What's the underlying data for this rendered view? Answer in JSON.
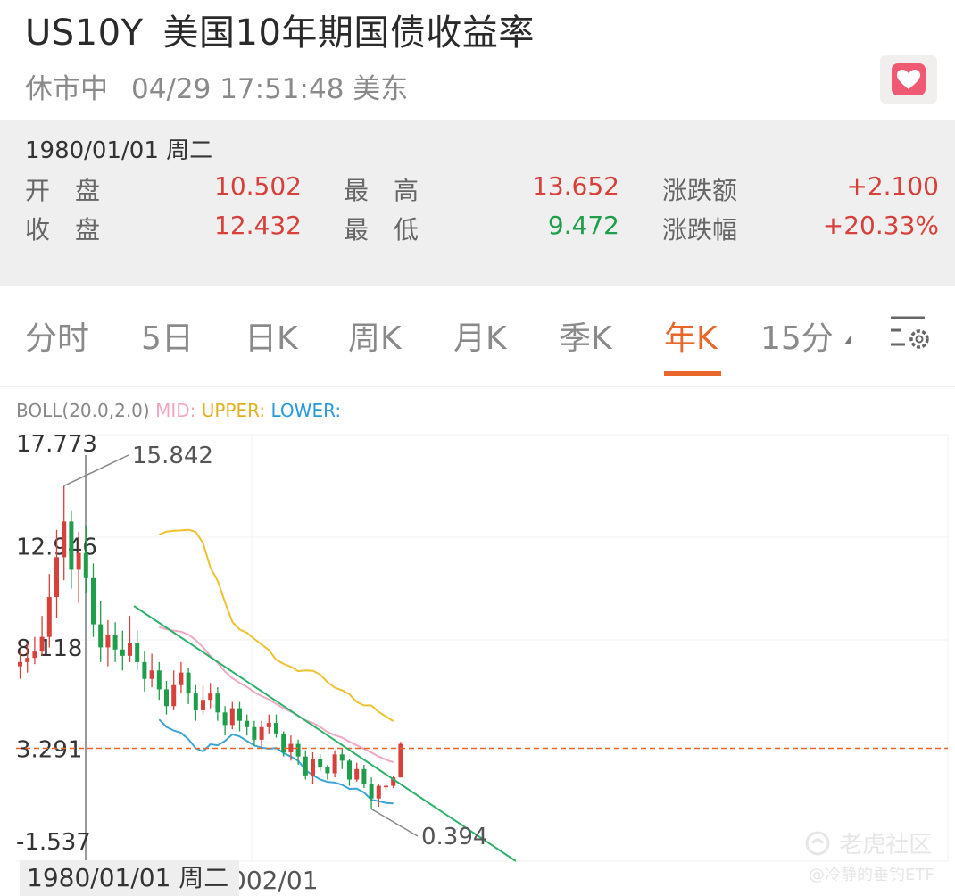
{
  "header": {
    "symbol": "US10Y",
    "name": "美国10年期国债收益率",
    "market_status": "休市中",
    "timestamp": "04/29 17:51:48 美东"
  },
  "quote": {
    "date": "1980/01/01 周二",
    "open_label": "开　盘",
    "open": "10.502",
    "close_label": "收　盘",
    "close": "12.432",
    "high_label": "最　高",
    "high": "13.652",
    "low_label": "最　低",
    "low": "9.472",
    "change_label": "涨跌额",
    "change": "+2.100",
    "change_pct_label": "涨跌幅",
    "change_pct": "+20.33%"
  },
  "tabs": [
    "分时",
    "5日",
    "日K",
    "周K",
    "月K",
    "季K",
    "年K",
    "15分"
  ],
  "active_tab": "年K",
  "indicator": {
    "name": "BOLL(20.0,2.0)",
    "mid": "MID:",
    "upper": "UPPER:",
    "lower": "LOWER:"
  },
  "colors": {
    "up": "#d8403c",
    "down": "#1e9e4a",
    "mid": "#f0a8c0",
    "upper": "#f0c030",
    "lower": "#3aa6d8",
    "trend": "#2cb36a",
    "ref": "#e8662a",
    "accent": "#e8662a"
  },
  "chart_data": {
    "type": "candlestick",
    "y_ticks": [
      "17.773",
      "12.946",
      "8.118",
      "3.291",
      "-1.537"
    ],
    "ylim": [
      -1.537,
      17.773
    ],
    "x_label_partial": "002/01",
    "max_label": "15.842",
    "min_label": "0.394",
    "reference_line": 3.291,
    "candles": [
      [
        7.2,
        7.4,
        8.0,
        6.6
      ],
      [
        7.4,
        7.6,
        8.3,
        6.9
      ],
      [
        7.6,
        7.9,
        8.6,
        7.3
      ],
      [
        7.9,
        8.6,
        9.6,
        7.7
      ],
      [
        8.6,
        10.5,
        11.6,
        8.1
      ],
      [
        10.5,
        12.4,
        13.7,
        9.5
      ],
      [
        12.4,
        14.1,
        15.8,
        11.3
      ],
      [
        14.1,
        11.8,
        14.6,
        10.9
      ],
      [
        11.8,
        12.6,
        13.6,
        10.2
      ],
      [
        12.6,
        11.4,
        13.9,
        10.7
      ],
      [
        11.4,
        9.2,
        12.1,
        8.6
      ],
      [
        9.2,
        8.1,
        10.3,
        7.4
      ],
      [
        8.1,
        8.7,
        9.4,
        7.2
      ],
      [
        8.7,
        8.0,
        9.3,
        7.4
      ],
      [
        8.0,
        7.7,
        8.9,
        7.0
      ],
      [
        7.7,
        8.3,
        9.6,
        7.4
      ],
      [
        8.3,
        7.4,
        8.9,
        7.0
      ],
      [
        7.4,
        6.6,
        7.9,
        6.0
      ],
      [
        6.6,
        7.0,
        7.8,
        6.2
      ],
      [
        7.0,
        6.1,
        7.4,
        5.6
      ],
      [
        6.1,
        5.3,
        6.5,
        4.9
      ],
      [
        5.3,
        6.3,
        7.0,
        5.1
      ],
      [
        6.3,
        6.9,
        7.4,
        5.9
      ],
      [
        6.9,
        5.9,
        7.1,
        5.4
      ],
      [
        5.9,
        5.1,
        6.3,
        4.6
      ],
      [
        5.1,
        5.6,
        6.3,
        4.9
      ],
      [
        5.6,
        5.9,
        6.4,
        5.2
      ],
      [
        5.9,
        5.0,
        6.2,
        4.6
      ],
      [
        5.0,
        4.4,
        5.3,
        3.9
      ],
      [
        4.4,
        5.2,
        5.5,
        4.2
      ],
      [
        5.2,
        4.6,
        5.5,
        4.1
      ],
      [
        4.6,
        4.3,
        4.9,
        3.9
      ],
      [
        4.3,
        3.7,
        4.6,
        3.4
      ],
      [
        3.7,
        4.3,
        4.6,
        3.3
      ],
      [
        4.3,
        4.5,
        4.9,
        4.0
      ],
      [
        4.5,
        4.0,
        4.9,
        3.8
      ],
      [
        4.0,
        3.1,
        4.1,
        2.9
      ],
      [
        3.1,
        3.5,
        3.9,
        2.7
      ],
      [
        3.5,
        2.9,
        3.7,
        2.5
      ],
      [
        2.9,
        2.0,
        3.2,
        1.8
      ],
      [
        2.0,
        2.8,
        3.1,
        1.6
      ],
      [
        2.8,
        2.4,
        3.0,
        2.2
      ],
      [
        2.4,
        2.1,
        2.5,
        1.8
      ],
      [
        2.1,
        3.0,
        3.2,
        1.9
      ],
      [
        3.0,
        2.7,
        3.3,
        2.3
      ],
      [
        2.7,
        1.8,
        2.8,
        1.5
      ],
      [
        1.8,
        2.3,
        2.6,
        1.7
      ],
      [
        2.3,
        1.6,
        2.5,
        1.4
      ],
      [
        1.6,
        0.9,
        1.9,
        0.4
      ],
      [
        0.9,
        1.5,
        1.6,
        0.5
      ],
      [
        1.5,
        1.5,
        1.6,
        1.3
      ],
      [
        1.5,
        1.9,
        2.0,
        1.4
      ],
      [
        1.9,
        3.5,
        3.6,
        1.9
      ]
    ]
  },
  "watermark": {
    "brand": "老虎社区",
    "author": "@冷静的垂钓ETF"
  }
}
